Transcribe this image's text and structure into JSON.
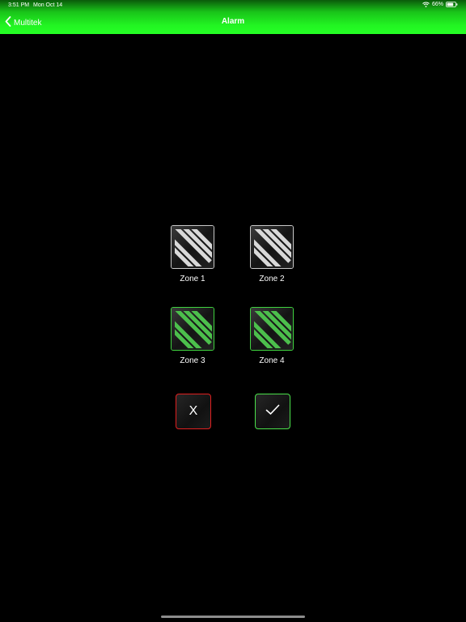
{
  "status_bar": {
    "time": "3:51 PM",
    "date": "Mon Oct 14",
    "battery": "66%"
  },
  "nav": {
    "back_label": "Multitek",
    "title": "Alarm"
  },
  "zones": [
    {
      "label": "Zone 1",
      "state": "inactive",
      "color": "#d9d9d9"
    },
    {
      "label": "Zone 2",
      "state": "inactive",
      "color": "#d9d9d9"
    },
    {
      "label": "Zone 3",
      "state": "active",
      "color": "#4cbf4c"
    },
    {
      "label": "Zone 4",
      "state": "active",
      "color": "#4cbf4c"
    }
  ],
  "actions": {
    "cancel_label": "X",
    "confirm_icon": "checkmark-icon"
  },
  "colors": {
    "header_green": "#25ff25",
    "cancel_border": "#e02020",
    "confirm_border": "#4ae04a"
  }
}
